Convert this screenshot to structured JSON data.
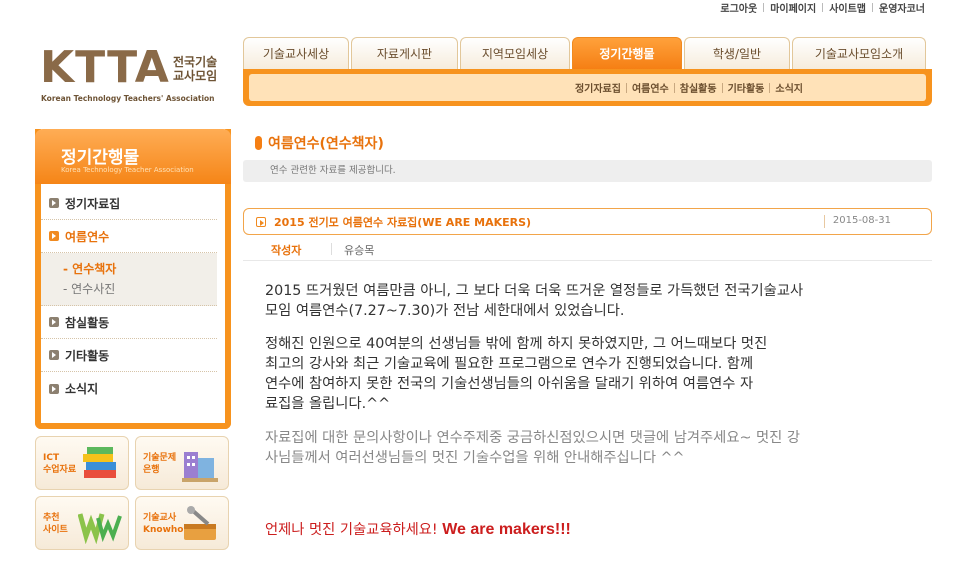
{
  "util_links": [
    "로그아웃",
    "마이페이지",
    "사이트맵",
    "운영자코너"
  ],
  "logo": {
    "mark": "KTTA",
    "korean_line1": "전국기술",
    "korean_line2": "교사모임",
    "english": "Korean Technology Teachers' Association"
  },
  "tabs": [
    {
      "label": "기술교사세상",
      "active": false
    },
    {
      "label": "자료게시판",
      "active": false
    },
    {
      "label": "지역모임세상",
      "active": false
    },
    {
      "label": "정기간행물",
      "active": true
    },
    {
      "label": "학생/일반",
      "active": false
    },
    {
      "label": "기술교사모임소개",
      "active": false
    }
  ],
  "subnav": [
    "정기자료집",
    "여름연수",
    "참실활동",
    "기타활동",
    "소식지"
  ],
  "sidebar": {
    "title": "정기간행물",
    "subtitle": "Korea Technology Teacher Association",
    "items": [
      "정기자료집",
      "여름연수",
      "참실활동",
      "기타활동",
      "소식지"
    ],
    "sub_items": [
      "- 연수책자",
      "- 연수사진"
    ]
  },
  "banners": [
    {
      "line1": "ICT",
      "line2": "수업자료"
    },
    {
      "line1": "기술문제",
      "line2": "은행"
    },
    {
      "line1": "추천",
      "line2": "사이트"
    },
    {
      "line1": "기술교사",
      "line2": "Knowhow"
    }
  ],
  "content": {
    "title": "여름연수(연수책자)",
    "description": "연수 관련한 자료를 제공합니다.",
    "post_title": "2015 전기모 여름연수 자료집(WE ARE MAKERS)",
    "post_date": "2015-08-31",
    "author_label": "작성자",
    "author": "유승목",
    "para1_line1": "2015 뜨거웠던 여름만큼 아니, 그 보다 더욱 더욱 뜨거운 열정들로 가득했던 전국기술교사",
    "para1_line2": "모임 여름연수(7.27~7.30)가 전남 세한대에서 있었습니다.",
    "para2_line1": "정해진 인원으로 40여분의 선생님들 밖에 함께 하지 못하였지만, 그 어느때보다 멋진",
    "para2_line2": "최고의 강사와 최근 기술교육에 필요한 프로그램으로 연수가 진행되었습니다.  함께",
    "para2_line3": "연수에 참여하지 못한 전국의 기술선생님들의 아쉬움을 달래기 위하여 여름연수 자",
    "para2_line4": "료집을 올립니다.^^",
    "para3_line1": "자료집에 대한 문의사항이나 연수주제중 궁금하신점있으시면 댓글에 남겨주세요~ 멋진 강",
    "para3_line2": "사님들께서 여러선생님들의 멋진 기술수업을 위해 안내해주십니다 ^^",
    "closing_ko": "언제나 멋진 기술교육하세요! ",
    "closing_en": "We are makers!!!"
  },
  "colors": {
    "accent": "#f7931e",
    "accent_text": "#e8720c",
    "closing": "#cc1e1e"
  }
}
